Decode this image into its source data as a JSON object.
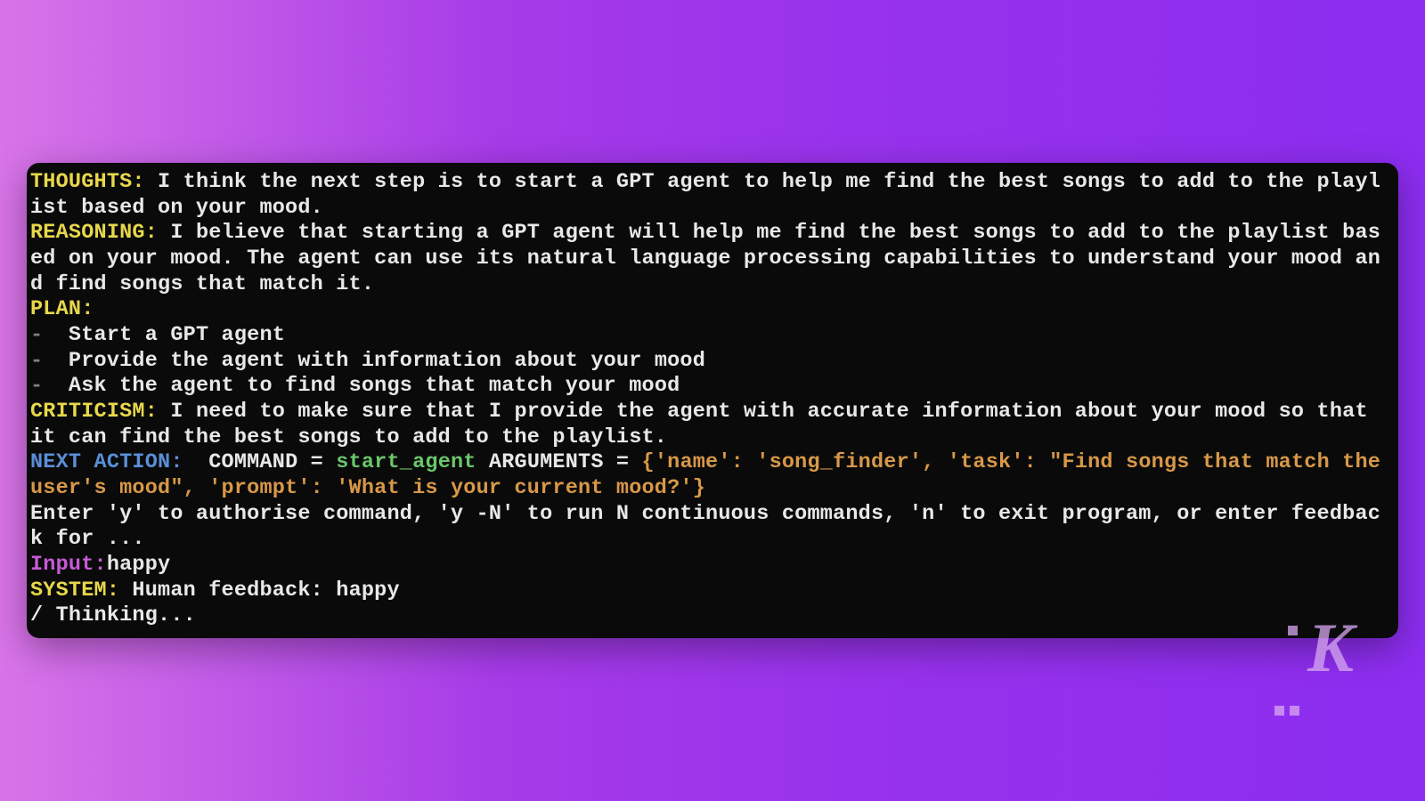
{
  "labels": {
    "thoughts": "THOUGHTS:",
    "reasoning": "REASONING:",
    "plan": "PLAN:",
    "criticism": "CRITICISM:",
    "next_action": "NEXT ACTION:",
    "input": "Input:",
    "system": "SYSTEM:"
  },
  "thoughts": " I think the next step is to start a GPT agent to help me find the best songs to add to the playlist based on your mood.",
  "reasoning": " I believe that starting a GPT agent will help me find the best songs to add to the playlist based on your mood. The agent can use its natural language processing capabilities to understand your mood and find songs that match it.",
  "plan_items": [
    "Start a GPT agent",
    "Provide the agent with information about your mood",
    "Ask the agent to find songs that match your mood"
  ],
  "criticism": " I need to make sure that I provide the agent with accurate information about your mood so that it can find the best songs to add to the playlist.",
  "next_action": {
    "command_label": "COMMAND = ",
    "command_value": "start_agent",
    "arguments_label": " ARGUMENTS = ",
    "arguments_value": "{'name': 'song_finder', 'task': \"Find songs that match the user's mood\", 'prompt': 'What is your current mood?'}"
  },
  "auth_prompt": "Enter 'y' to authorise command, 'y -N' to run N continuous commands, 'n' to exit program, or enter feedback for ...",
  "input_value": "happy",
  "system_message": " Human feedback: happy",
  "thinking": "/ Thinking...",
  "dash": "-  ",
  "watermark": "K"
}
